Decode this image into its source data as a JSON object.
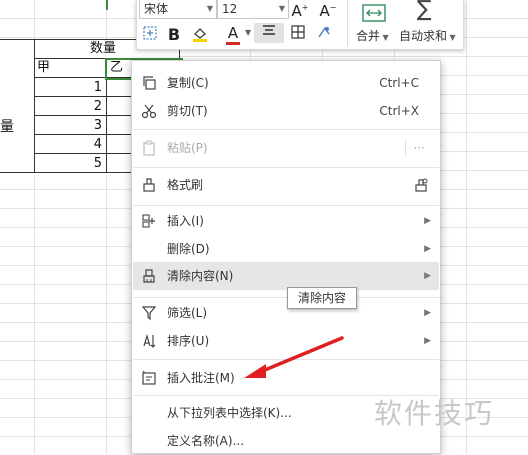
{
  "sheet": {
    "header_quantity": "数量",
    "col_a": "甲",
    "col_b": "乙",
    "row_label": "量",
    "numbers": [
      "1",
      "2",
      "3",
      "4",
      "5"
    ]
  },
  "toolbar": {
    "font_name": "宋体",
    "font_size": "12",
    "grow_font": "A⁺",
    "shrink_font": "A⁻",
    "bold": "B",
    "font_color_glyph": "A",
    "merge_label": "合并",
    "autosum_label": "自动求和",
    "sigma": "∑"
  },
  "menu": {
    "items": [
      {
        "label": "复制(C)",
        "shortcut": "Ctrl+C"
      },
      {
        "label": "剪切(T)",
        "shortcut": "Ctrl+X"
      },
      {
        "label": "粘贴(P)",
        "shortcut": "···"
      },
      {
        "label": "格式刷"
      },
      {
        "label": "插入(I)"
      },
      {
        "label": "删除(D)"
      },
      {
        "label": "清除内容(N)"
      },
      {
        "label": "筛选(L)"
      },
      {
        "label": "排序(U)"
      },
      {
        "label": "插入批注(M)"
      },
      {
        "label": "从下拉列表中选择(K)..."
      },
      {
        "label": "定义名称(A)..."
      }
    ]
  },
  "tooltip": "清除内容",
  "watermark": "软件技巧",
  "colors": {
    "selection_green": "#3c8a3c",
    "arrow_red": "#e02020",
    "font_red": "#d42a2a",
    "highlight_yellow": "#f5d600"
  }
}
